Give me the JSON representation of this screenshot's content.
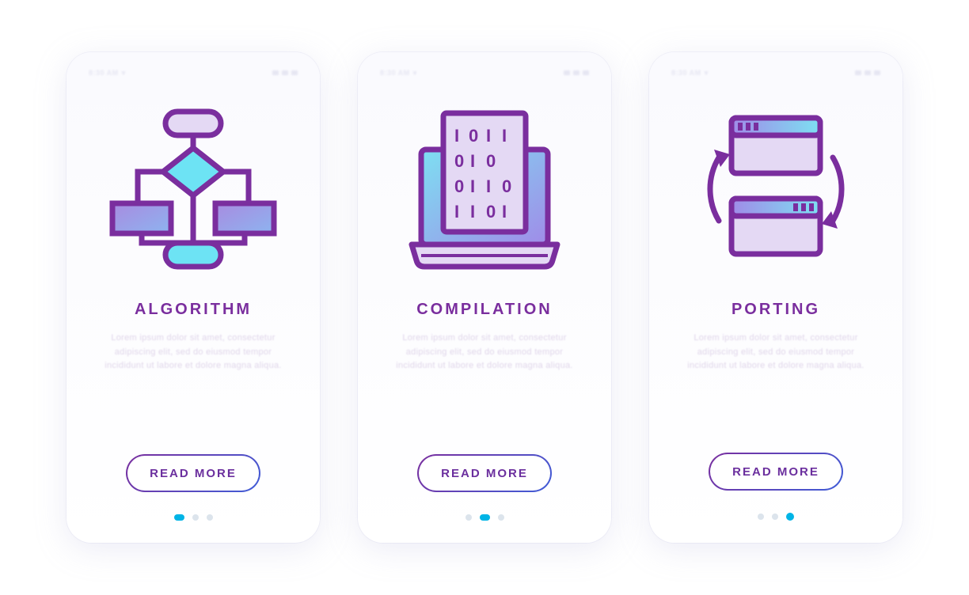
{
  "status_bar": {
    "time": "8:30 AM",
    "signal_icon": "signal-icon",
    "battery_icon": "battery-icon"
  },
  "cards": [
    {
      "title": "ALGORITHM",
      "description": "Lorem ipsum dolor sit amet, consectetur adipiscing elit, sed do eiusmod tempor incididunt ut labore et dolore magna aliqua.",
      "button_label": "READ MORE",
      "icon": "flowchart-icon",
      "active_dot": 0
    },
    {
      "title": "COMPILATION",
      "description": "Lorem ipsum dolor sit amet, consectetur adipiscing elit, sed do eiusmod tempor incididunt ut labore et dolore magna aliqua.",
      "button_label": "READ MORE",
      "icon": "laptop-binary-icon",
      "active_dot": 1
    },
    {
      "title": "PORTING",
      "description": "Lorem ipsum dolor sit amet, consectetur adipiscing elit, sed do eiusmod tempor incididunt ut labore et dolore magna aliqua.",
      "button_label": "READ MORE",
      "icon": "windows-sync-icon",
      "active_dot": 2
    }
  ],
  "colors": {
    "stroke_purple": "#7a2e9e",
    "fill_light_purple": "#e4d9f4",
    "fill_cyan": "#6de3f4",
    "gradient_a": "#a47be0",
    "gradient_b": "#6dd4f4"
  }
}
